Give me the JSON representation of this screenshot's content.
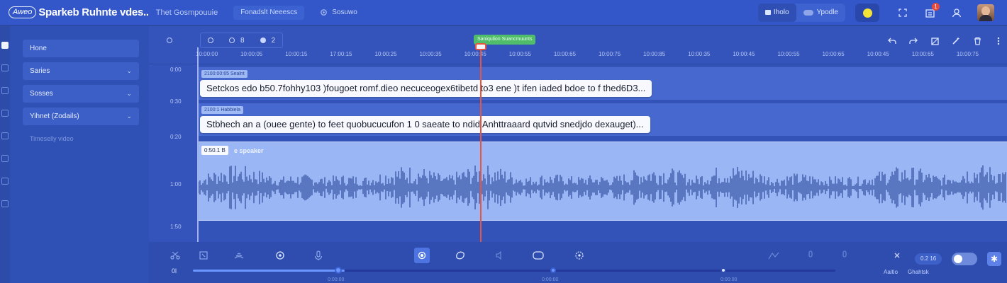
{
  "app": {
    "logo_badge": "Aweo",
    "title": "Sparkeb Ruhnte vdes..",
    "subtitle": "Thet Gosmpouuie",
    "pill_label": "Fonadslt Neeescs",
    "pill2_label": "Sosuwo"
  },
  "top_right": {
    "mode_left": "Iholo",
    "mode_right": "Ypodle",
    "notification_count": "1"
  },
  "sidebar": {
    "items": [
      {
        "label": "Hone",
        "chevron": false
      },
      {
        "label": "Saries",
        "chevron": true
      },
      {
        "label": "Sosses",
        "chevron": true
      },
      {
        "label": "Yihnet (Zodails)",
        "chevron": true
      }
    ],
    "muted_text": "Timeselly video"
  },
  "timeline": {
    "controls": {
      "zoom_a": "8",
      "zoom_b": "2"
    },
    "ruler_ticks": [
      "10:00:00",
      "10:00:05",
      "10:00:15",
      "17:00:15",
      "10:00:25",
      "10:00:35",
      "10:00:45",
      "10:00:55",
      "10:00:65",
      "10:00:75",
      "10:00:85",
      "10:00:35",
      "10:00:45",
      "10:00:55",
      "10:00:65",
      "10:00:45",
      "10:00:65",
      "10:00:75"
    ],
    "row_labels": [
      "0:00",
      "0:30",
      "0:20",
      "1:00",
      "1:50"
    ],
    "playhead_label": "Saniqulion Suancmuunts",
    "captions": [
      {
        "tag": "2100:00:65 Sealnt",
        "text": "Setckos edo b50.7fohhy103 )fougoet romf.dieo necuceogex6tibetd to3 ene )t ifen iaded bdoe to f thed6D3..."
      },
      {
        "tag": "2100:1 Habbiela",
        "text": "Stbhech an a (ouee gente) to feet quobucucufon 1 0 saeate to ndid Anhttraaard qutvid snedjdo dexauget)..."
      }
    ],
    "audio_tag": "0:50.1 B",
    "audio_label": "e speaker"
  },
  "bottom": {
    "left_label": "0l",
    "speed": "0.2 16",
    "right_labels": [
      "Aaitio",
      "Ghahtsk"
    ],
    "scrub_labels": [
      "0:00:00",
      "0:00:00",
      "0:00:00"
    ],
    "progress_fraction": 0.236
  },
  "colors": {
    "accent": "#3357c8",
    "playhead": "#e8543e",
    "audio_track": "#9ab6f4",
    "waveform": "#2f4c9e",
    "marker": "#4fbd6a"
  }
}
